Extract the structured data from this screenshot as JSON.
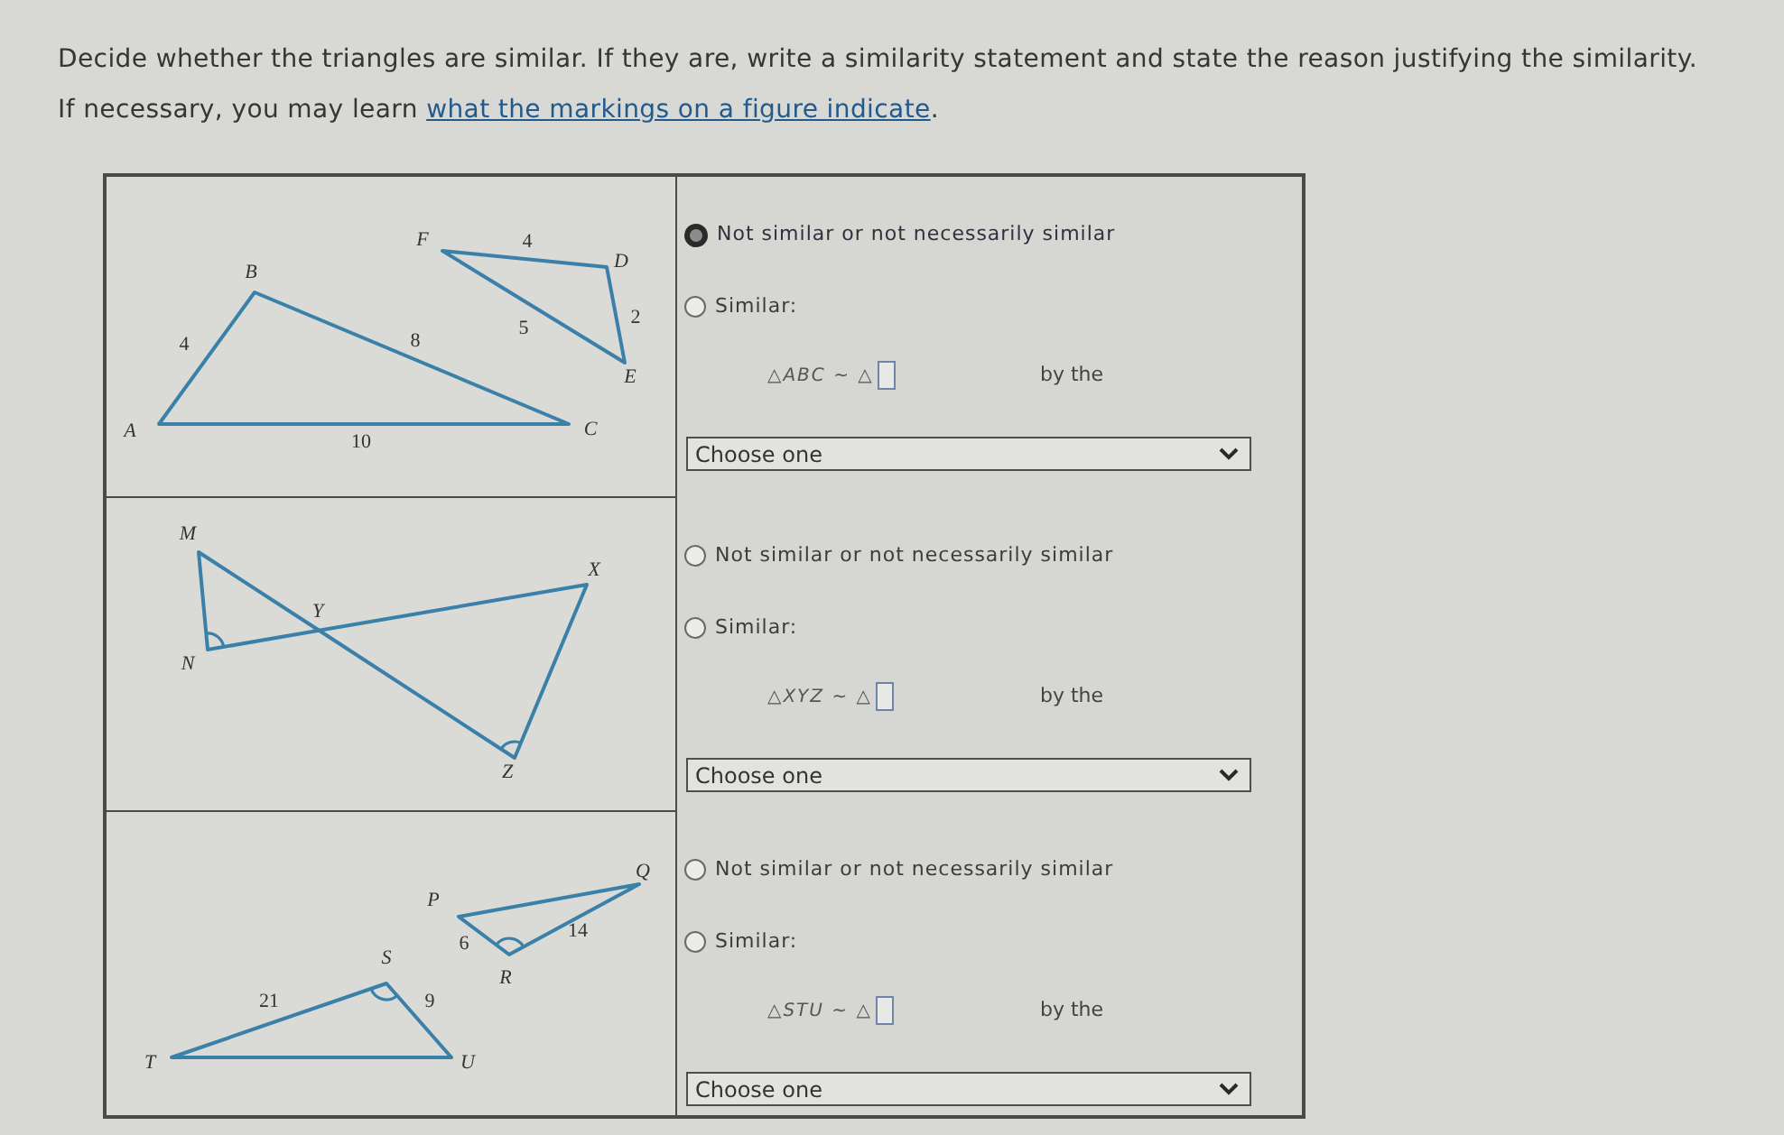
{
  "instructions": {
    "text": "Decide whether the triangles are similar. If they are, write a similarity statement and state the reason justifying the similarity.",
    "help_prefix": "If necessary, you may learn ",
    "help_link": "what the markings on a figure indicate",
    "help_suffix": "."
  },
  "problems": [
    {
      "figure": {
        "points": [
          "A",
          "B",
          "C",
          "F",
          "D",
          "E"
        ],
        "lengths": [
          "4",
          "8",
          "10",
          "4",
          "2",
          "5"
        ]
      },
      "choices": [
        {
          "label": "Not similar or not necessarily similar",
          "selected": true
        },
        {
          "label": "Similar:",
          "selected": false
        }
      ],
      "statement": "△*ABC* ~ △",
      "by_the": "by the",
      "reason_dropdown": {
        "value": "Choose one"
      }
    },
    {
      "figure": {
        "points": [
          "M",
          "N",
          "Y",
          "X",
          "Z"
        ]
      },
      "choices": [
        {
          "label": "Not similar or not necessarily similar",
          "selected": false
        },
        {
          "label": "Similar:",
          "selected": false
        }
      ],
      "statement": "△*XYZ* ~ △",
      "by_the": "by the",
      "reason_dropdown": {
        "value": "Choose one"
      }
    },
    {
      "figure": {
        "points": [
          "T",
          "U",
          "S",
          "P",
          "R",
          "Q"
        ],
        "lengths": [
          "21",
          "9",
          "6",
          "14"
        ]
      },
      "choices": [
        {
          "label": "Not similar or not necessarily similar",
          "selected": false
        },
        {
          "label": "Similar:",
          "selected": false
        }
      ],
      "statement": "△*STU* ~ △",
      "by_the": "by the",
      "reason_dropdown": {
        "value": "Choose one"
      }
    }
  ]
}
